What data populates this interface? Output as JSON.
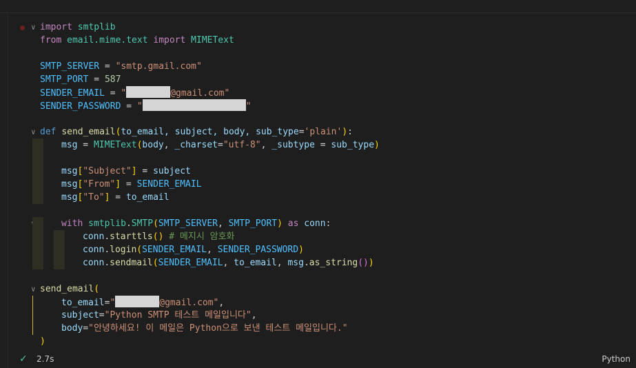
{
  "code": {
    "l1": {
      "import_kw": "import",
      "module": "smtplib"
    },
    "l2": {
      "from_kw": "from",
      "module": "email.mime.text",
      "import_kw": "import",
      "cls": "MIMEText"
    },
    "l4": {
      "name": "SMTP_SERVER",
      "value": "\"smtp.gmail.com\""
    },
    "l5": {
      "name": "SMTP_PORT",
      "value": "587"
    },
    "l6": {
      "name": "SENDER_EMAIL",
      "value_suffix": "@gmail.com\""
    },
    "l7": {
      "name": "SENDER_PASSWORD"
    },
    "l9": {
      "def_kw": "def",
      "func": "send_email",
      "params": "to_email, subject, body, sub_type",
      "default": "'plain'"
    },
    "l10": {
      "var": "msg",
      "call": "MIMEText",
      "arg": "body",
      "kw1": "_charset",
      "val1": "\"utf-8\"",
      "kw2": "_subtype",
      "val2": "sub_type"
    },
    "l12": {
      "key": "\"Subject\"",
      "value": "subject"
    },
    "l13": {
      "key": "\"From\"",
      "value": "SENDER_EMAIL"
    },
    "l14": {
      "key": "\"To\"",
      "value": "to_email"
    },
    "l16": {
      "with_kw": "with",
      "mod": "smtplib",
      "cls": "SMTP",
      "a1": "SMTP_SERVER",
      "a2": "SMTP_PORT",
      "as_kw": "as",
      "alias": "conn"
    },
    "l17": {
      "obj": "conn",
      "method": "starttls",
      "comment": "# 메지시 암호화"
    },
    "l18": {
      "obj": "conn",
      "method": "login",
      "a1": "SENDER_EMAIL",
      "a2": "SENDER_PASSWORD"
    },
    "l19": {
      "obj": "conn",
      "method": "sendmail",
      "a1": "SENDER_EMAIL",
      "a2": "to_email",
      "a3": "msg",
      "m2": "as_string"
    },
    "l21": {
      "func": "send_email"
    },
    "l22": {
      "kw": "to_email",
      "value_suffix": "@gmail.com\""
    },
    "l23": {
      "kw": "subject",
      "value": "\"Python SMTP 테스트 메일입니다\""
    },
    "l24": {
      "kw": "body",
      "value": "\"안녕하세요! 이 메일은 Python으로 보낸 테스트 메일입니다.\""
    }
  },
  "status": {
    "check_icon": "check-icon",
    "duration": "2.7s",
    "language": "Python"
  },
  "colors": {
    "keyword": "#569cd6",
    "control": "#c586c0",
    "function": "#dcdcaa",
    "class": "#4ec9b0",
    "constant": "#4fc1ff",
    "string": "#ce9178",
    "number": "#b5cea8",
    "comment": "#6a9955"
  }
}
